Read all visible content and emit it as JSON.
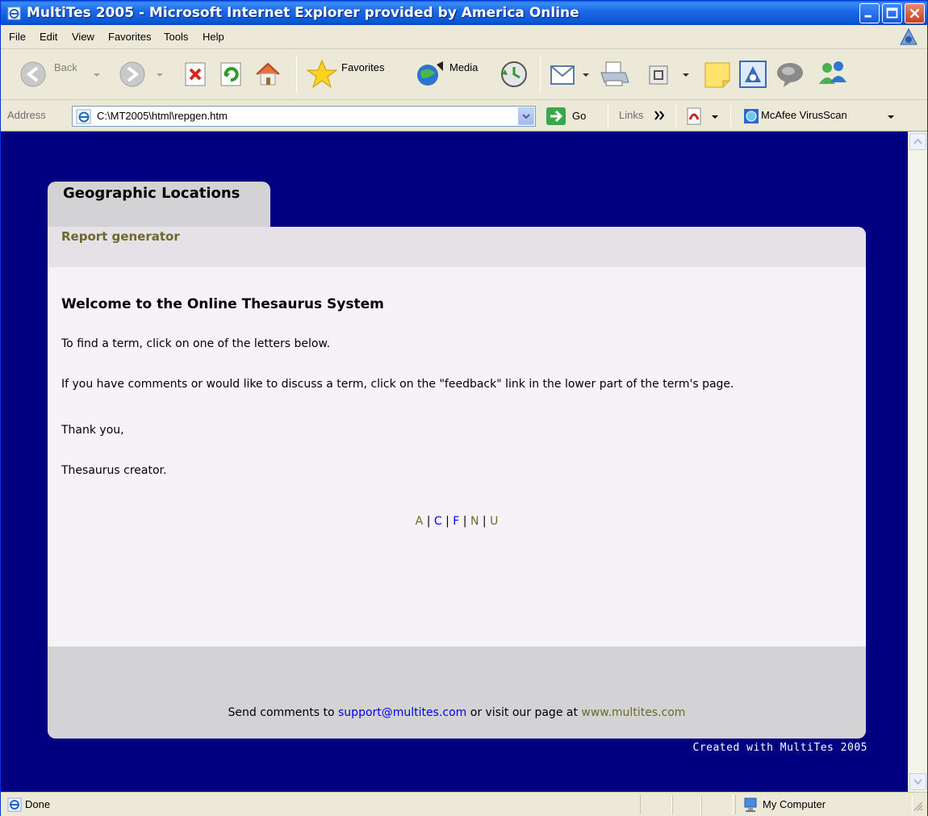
{
  "window": {
    "title": "MultiTes 2005 - Microsoft Internet Explorer provided by America Online"
  },
  "menu": {
    "items": [
      "File",
      "Edit",
      "View",
      "Favorites",
      "Tools",
      "Help"
    ]
  },
  "toolbar": {
    "back_label": "Back",
    "favorites_label": "Favorites",
    "media_label": "Media"
  },
  "address": {
    "label": "Address",
    "url": "C:\\MT2005\\html\\repgen.htm",
    "go_label": "Go",
    "links_label": "Links",
    "mcafee_label": "McAfee VirusScan"
  },
  "page": {
    "tab_title": "Geographic Locations",
    "subtitle": "Report generator",
    "welcome": "Welcome to the Online Thesaurus System",
    "para1": "To find a term, click on one of the letters below.",
    "para2": "If you have comments or would like to discuss a term, click on the \"feedback\" link in the lower part of the term's page.",
    "para3": "Thank you,",
    "para4": "Thesaurus creator.",
    "letters": [
      "A",
      "C",
      "F",
      "N",
      "U"
    ],
    "letter_separator": "|",
    "footer_prefix": "Send comments to ",
    "footer_email": "support@multites.com",
    "footer_middle": " or visit our page at ",
    "footer_site": "www.multites.com",
    "created": "Created with MultiTes 2005"
  },
  "status": {
    "text": "Done",
    "zone": "My Computer"
  },
  "colors": {
    "page_bg": "#000080",
    "accent_olive": "#6a6a2a",
    "link_blue": "#0000ee"
  }
}
